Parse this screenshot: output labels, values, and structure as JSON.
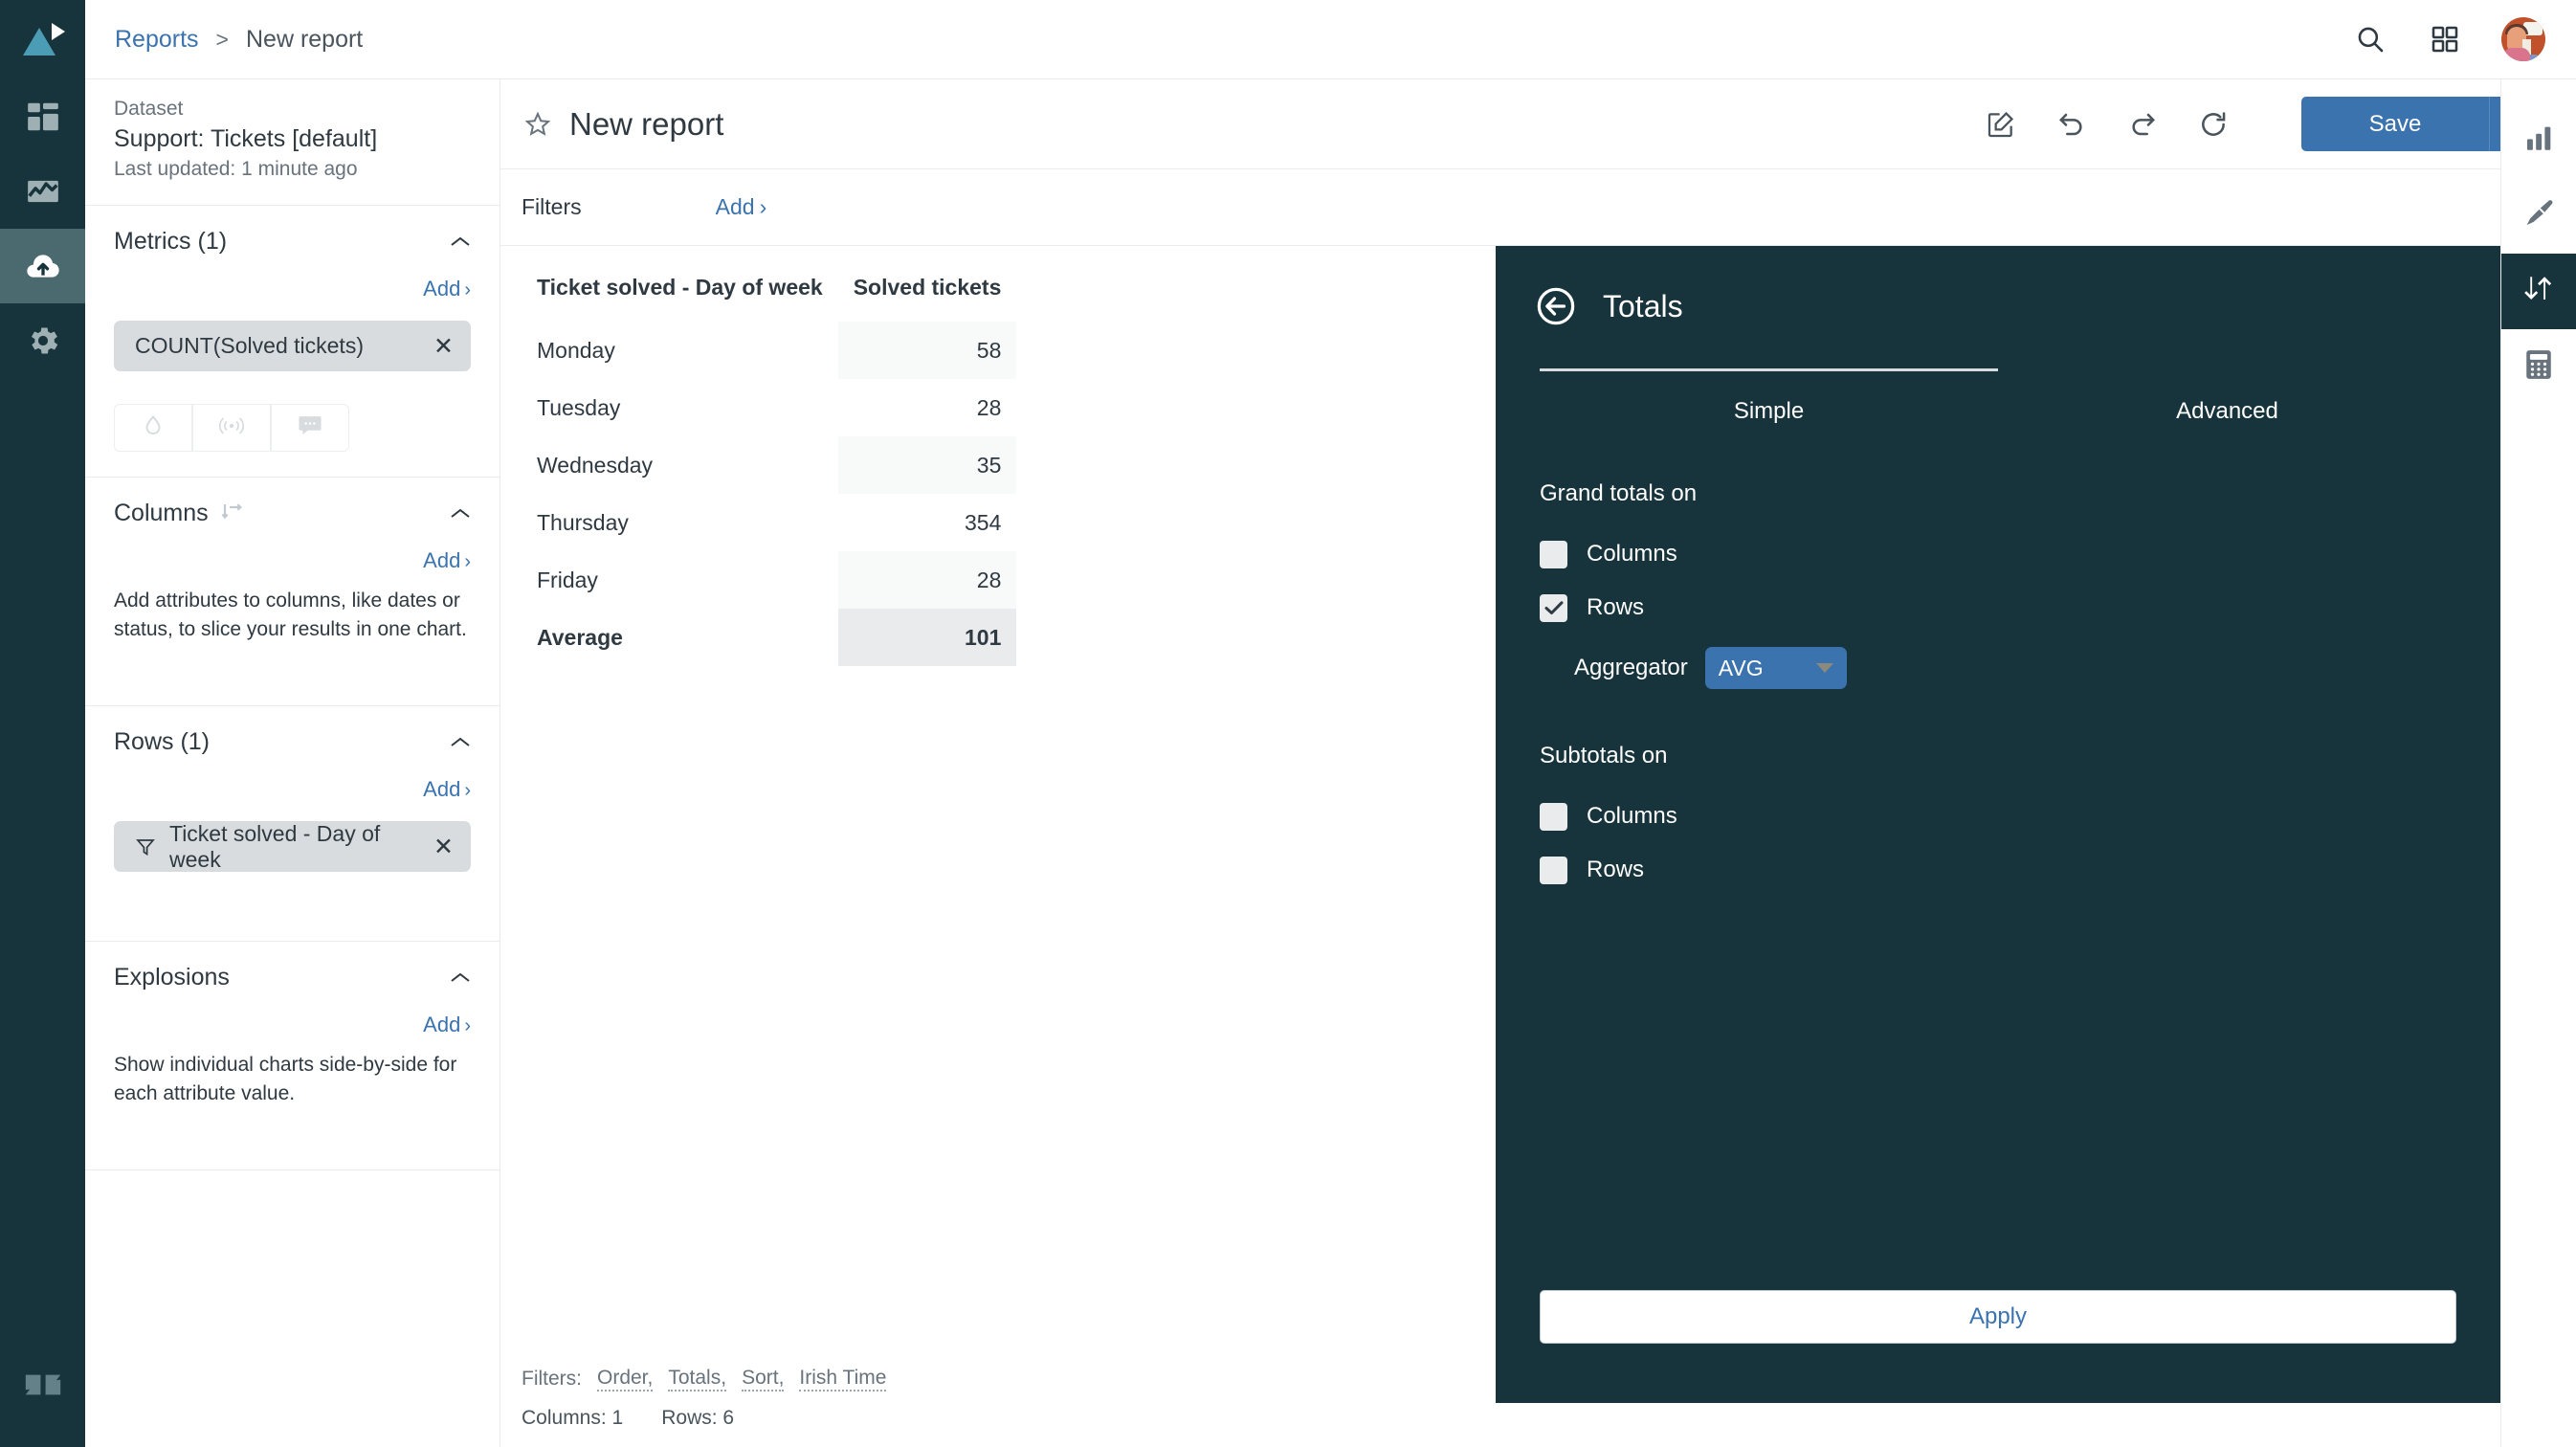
{
  "app": {
    "logo_name": "explore-logo",
    "brand_dark": "#17333b",
    "accent_blue": "#3b73af",
    "link_blue": "#3b73af",
    "logo_teal": "#4b9cb5"
  },
  "nav_rail": {
    "items": [
      {
        "label": "Dashboards",
        "icon": "dashboard-icon",
        "active": false
      },
      {
        "label": "Reports",
        "icon": "chart-line-icon",
        "active": false
      },
      {
        "label": "Datasets",
        "icon": "cloud-upload-icon",
        "active": true
      },
      {
        "label": "Admin",
        "icon": "gear-icon",
        "active": false
      }
    ],
    "footer_logo": "zendesk-logo"
  },
  "header": {
    "breadcrumb": {
      "root": "Reports",
      "separator": ">",
      "current": "New report"
    },
    "search_icon": "search-icon",
    "apps_icon": "grid-apps-icon",
    "avatar": "user-avatar"
  },
  "left_panel": {
    "dataset": {
      "label": "Dataset",
      "name": "Support: Tickets [default]",
      "updated": "Last updated: 1 minute ago"
    },
    "metrics": {
      "title": "Metrics (1)",
      "add_label": "Add",
      "add_caret": "›",
      "items": [
        {
          "label": "COUNT(Solved tickets)",
          "remove": "✕"
        }
      ],
      "mini_buttons": [
        {
          "name": "drill-through-icon",
          "label": "Drill through"
        },
        {
          "name": "live-data-icon",
          "label": "Live data"
        },
        {
          "name": "annotation-icon",
          "label": "Annotations"
        }
      ]
    },
    "columns": {
      "title": "Columns",
      "add_label": "Add",
      "add_caret": "›",
      "help": "Add attributes to columns, like dates or status, to slice your results in one chart.",
      "items": []
    },
    "rows": {
      "title": "Rows (1)",
      "add_label": "Add",
      "add_caret": "›",
      "items": [
        {
          "label": "Ticket solved - Day of week",
          "remove": "✕",
          "icon": "filter-funnel-icon"
        }
      ]
    },
    "explosions": {
      "title": "Explosions",
      "add_label": "Add",
      "add_caret": "›",
      "help": "Show individual charts side-by-side for each attribute value."
    }
  },
  "main": {
    "star_icon": "star-outline-icon",
    "report_title": "New report",
    "toolbar": [
      {
        "name": "edit-icon",
        "label": "Edit"
      },
      {
        "name": "undo-icon",
        "label": "Undo"
      },
      {
        "name": "redo-icon",
        "label": "Redo"
      },
      {
        "name": "refresh-icon",
        "label": "Refresh"
      }
    ],
    "save_label": "Save",
    "save_caret_icon": "chevron-down-icon",
    "filters": {
      "label": "Filters",
      "add_label": "Add",
      "add_caret": "›"
    },
    "footer": {
      "filters_label": "Filters:",
      "links": [
        "Order,",
        "Totals,",
        "Sort,",
        "Irish Time"
      ],
      "columns_count": "Columns: 1",
      "rows_count": "Rows: 6"
    }
  },
  "chart_data": {
    "type": "table",
    "title": "",
    "columns": [
      "Ticket solved - Day of week",
      "Solved tickets"
    ],
    "categories": [
      "Monday",
      "Tuesday",
      "Wednesday",
      "Thursday",
      "Friday"
    ],
    "values": [
      58,
      28,
      35,
      354,
      28
    ],
    "rows": [
      {
        "label": "Monday",
        "value": "58",
        "total": false
      },
      {
        "label": "Tuesday",
        "value": "28",
        "total": false
      },
      {
        "label": "Wednesday",
        "value": "35",
        "total": false
      },
      {
        "label": "Thursday",
        "value": "354",
        "total": false
      },
      {
        "label": "Friday",
        "value": "28",
        "total": false
      },
      {
        "label": "Average",
        "value": "101",
        "total": true
      }
    ],
    "grand_total": {
      "label": "Average",
      "value": 101,
      "aggregator": "AVG"
    },
    "xlabel": "Ticket solved - Day of week",
    "ylabel": "Solved tickets"
  },
  "drawer": {
    "back_icon": "back-arrow-circle-icon",
    "title": "Totals",
    "tabs": [
      {
        "label": "Simple",
        "active": true
      },
      {
        "label": "Advanced",
        "active": false
      }
    ],
    "grand_totals": {
      "label": "Grand totals on",
      "options": [
        {
          "label": "Columns",
          "checked": false
        },
        {
          "label": "Rows",
          "checked": true
        }
      ],
      "aggregator_label": "Aggregator",
      "aggregator_value": "AVG"
    },
    "subtotals": {
      "label": "Subtotals on",
      "options": [
        {
          "label": "Columns",
          "checked": false
        },
        {
          "label": "Rows",
          "checked": false
        }
      ]
    },
    "apply_label": "Apply"
  },
  "right_rail": {
    "items": [
      {
        "name": "chart-type-icon",
        "label": "Visualization type",
        "active": false
      },
      {
        "name": "paintbrush-icon",
        "label": "Chart configuration",
        "active": false
      },
      {
        "name": "sort-arrows-icon",
        "label": "Result manipulation",
        "active": true
      },
      {
        "name": "calculator-icon",
        "label": "Calculations",
        "active": false
      }
    ]
  }
}
